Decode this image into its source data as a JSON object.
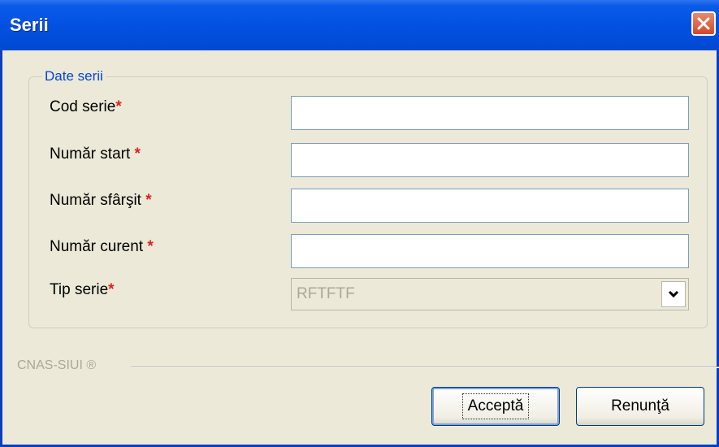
{
  "window": {
    "title": "Serii"
  },
  "group": {
    "legend": "Date serii"
  },
  "fields": {
    "cod_serie": {
      "label": "Cod serie",
      "required": "*",
      "value": ""
    },
    "numar_start": {
      "label": "Număr start",
      "required": "*",
      "value": ""
    },
    "numar_sfarsit": {
      "label": "Număr sfârşit",
      "required": "*",
      "value": ""
    },
    "numar_curent": {
      "label": "Număr curent",
      "required": "*",
      "value": ""
    },
    "tip_serie": {
      "label": "Tip serie",
      "required": "*",
      "selected": "RFTFTF"
    }
  },
  "footer": {
    "brand": "CNAS-SIUI ®"
  },
  "buttons": {
    "accept": "Acceptă",
    "cancel": "Renunţă"
  },
  "icons": {
    "close": "close-icon",
    "dropdown": "chevron-down-icon"
  },
  "colors": {
    "titlebar": "#0350E0",
    "required": "#E02020",
    "legend": "#0046D5",
    "background": "#ECE9D8"
  }
}
